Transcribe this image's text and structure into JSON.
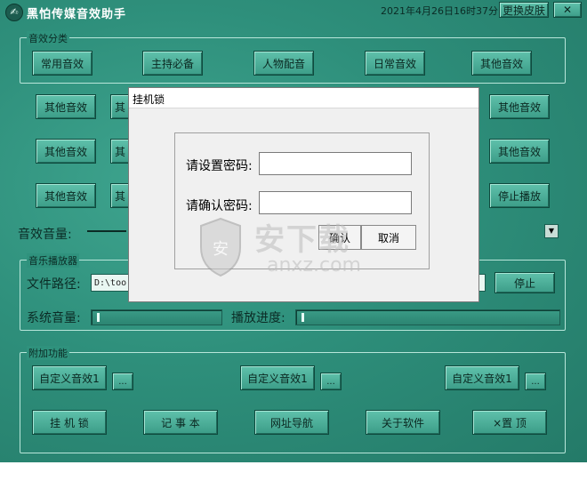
{
  "window": {
    "title": "黑怕传媒音效助手",
    "datetime": "2021年4月26日16时37分",
    "skin_label": "更换皮肤",
    "close_label": "✕"
  },
  "sound_category": {
    "group_label": "音效分类",
    "row1": [
      "常用音效",
      "主持必备",
      "人物配音",
      "日常音效",
      "其他音效"
    ],
    "rows_left": [
      "其他音效",
      "其他音效",
      "其他音效"
    ],
    "rows_left2": [
      "其",
      "其",
      "其"
    ],
    "rows_right": [
      "其他音效",
      "其他音效",
      "停止播放"
    ]
  },
  "volume": {
    "label": "音效音量:"
  },
  "music_player": {
    "group_label": "音乐播放器",
    "file_path_label": "文件路径:",
    "file_path_value": "D:\\too",
    "stop_label": "停止",
    "system_volume_label": "系统音量:",
    "progress_label": "播放进度:"
  },
  "extras": {
    "group_label": "附加功能",
    "custom_sounds": [
      "自定义音效1",
      "自定义音效1",
      "自定义音效1"
    ],
    "browse_label": "...",
    "bottom_buttons": [
      "挂 机 锁",
      "记 事 本",
      "网址导航",
      "关于软件",
      "×置  顶"
    ]
  },
  "dialog": {
    "title": "挂机锁",
    "set_password_label": "请设置密码:",
    "confirm_password_label": "请确认密码:",
    "confirm_label": "确认",
    "cancel_label": "取消"
  },
  "watermark": {
    "text": "安下载",
    "sub": "anxz.com"
  }
}
